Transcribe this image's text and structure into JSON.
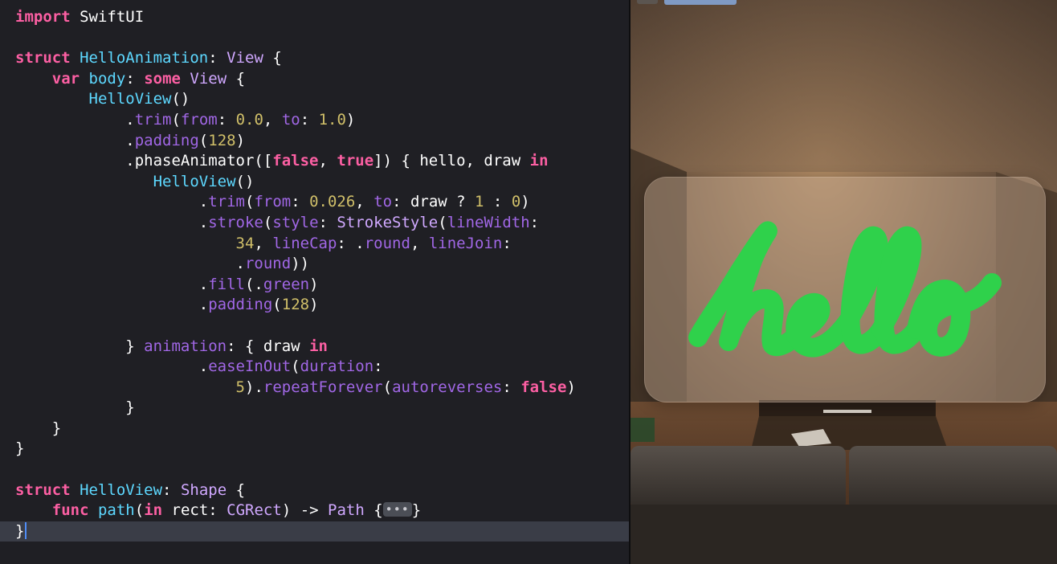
{
  "editor": {
    "lines": [
      [
        {
          "t": "import",
          "c": "kw"
        },
        {
          "t": " SwiftUI",
          "c": "pl"
        }
      ],
      [],
      [
        {
          "t": "struct",
          "c": "kw"
        },
        {
          "t": " ",
          "c": "pl"
        },
        {
          "t": "HelloAnimation",
          "c": "decl"
        },
        {
          "t": ": ",
          "c": "pl"
        },
        {
          "t": "View",
          "c": "ty"
        },
        {
          "t": " {",
          "c": "pl"
        }
      ],
      [
        {
          "t": "    ",
          "c": "pl"
        },
        {
          "t": "var",
          "c": "kw"
        },
        {
          "t": " ",
          "c": "pl"
        },
        {
          "t": "body",
          "c": "decl"
        },
        {
          "t": ": ",
          "c": "pl"
        },
        {
          "t": "some",
          "c": "kw"
        },
        {
          "t": " ",
          "c": "pl"
        },
        {
          "t": "View",
          "c": "ty"
        },
        {
          "t": " {",
          "c": "pl"
        }
      ],
      [
        {
          "t": "        ",
          "c": "pl"
        },
        {
          "t": "HelloView",
          "c": "decl"
        },
        {
          "t": "()",
          "c": "pl"
        }
      ],
      [
        {
          "t": "            .",
          "c": "pl"
        },
        {
          "t": "trim",
          "c": "prop"
        },
        {
          "t": "(",
          "c": "pl"
        },
        {
          "t": "from",
          "c": "prop"
        },
        {
          "t": ": ",
          "c": "pl"
        },
        {
          "t": "0.0",
          "c": "num"
        },
        {
          "t": ", ",
          "c": "pl"
        },
        {
          "t": "to",
          "c": "prop"
        },
        {
          "t": ": ",
          "c": "pl"
        },
        {
          "t": "1.0",
          "c": "num"
        },
        {
          "t": ")",
          "c": "pl"
        }
      ],
      [
        {
          "t": "            .",
          "c": "pl"
        },
        {
          "t": "padding",
          "c": "prop"
        },
        {
          "t": "(",
          "c": "pl"
        },
        {
          "t": "128",
          "c": "num"
        },
        {
          "t": ")",
          "c": "pl"
        }
      ],
      [
        {
          "t": "            .phaseAnimator([",
          "c": "pl"
        },
        {
          "t": "false",
          "c": "kw"
        },
        {
          "t": ", ",
          "c": "pl"
        },
        {
          "t": "true",
          "c": "kw"
        },
        {
          "t": "]) { hello, draw ",
          "c": "pl"
        },
        {
          "t": "in",
          "c": "kw"
        }
      ],
      [
        {
          "t": "               ",
          "c": "pl"
        },
        {
          "t": "HelloView",
          "c": "decl"
        },
        {
          "t": "()",
          "c": "pl"
        }
      ],
      [
        {
          "t": "                    .",
          "c": "pl"
        },
        {
          "t": "trim",
          "c": "prop"
        },
        {
          "t": "(",
          "c": "pl"
        },
        {
          "t": "from",
          "c": "prop"
        },
        {
          "t": ": ",
          "c": "pl"
        },
        {
          "t": "0.026",
          "c": "num"
        },
        {
          "t": ", ",
          "c": "pl"
        },
        {
          "t": "to",
          "c": "prop"
        },
        {
          "t": ": draw ? ",
          "c": "pl"
        },
        {
          "t": "1",
          "c": "num"
        },
        {
          "t": " : ",
          "c": "pl"
        },
        {
          "t": "0",
          "c": "num"
        },
        {
          "t": ")",
          "c": "pl"
        }
      ],
      [
        {
          "t": "                    .",
          "c": "pl"
        },
        {
          "t": "stroke",
          "c": "prop"
        },
        {
          "t": "(",
          "c": "pl"
        },
        {
          "t": "style",
          "c": "prop"
        },
        {
          "t": ": ",
          "c": "pl"
        },
        {
          "t": "StrokeStyle",
          "c": "ty"
        },
        {
          "t": "(",
          "c": "pl"
        },
        {
          "t": "lineWidth",
          "c": "prop"
        },
        {
          "t": ":",
          "c": "pl"
        }
      ],
      [
        {
          "t": "                        ",
          "c": "pl"
        },
        {
          "t": "34",
          "c": "num"
        },
        {
          "t": ", ",
          "c": "pl"
        },
        {
          "t": "lineCap",
          "c": "prop"
        },
        {
          "t": ": .",
          "c": "pl"
        },
        {
          "t": "round",
          "c": "prop"
        },
        {
          "t": ", ",
          "c": "pl"
        },
        {
          "t": "lineJoin",
          "c": "prop"
        },
        {
          "t": ":",
          "c": "pl"
        }
      ],
      [
        {
          "t": "                        .",
          "c": "pl"
        },
        {
          "t": "round",
          "c": "prop"
        },
        {
          "t": "))",
          "c": "pl"
        }
      ],
      [
        {
          "t": "                    .",
          "c": "pl"
        },
        {
          "t": "fill",
          "c": "prop"
        },
        {
          "t": "(.",
          "c": "pl"
        },
        {
          "t": "green",
          "c": "prop"
        },
        {
          "t": ")",
          "c": "pl"
        }
      ],
      [
        {
          "t": "                    .",
          "c": "pl"
        },
        {
          "t": "padding",
          "c": "prop"
        },
        {
          "t": "(",
          "c": "pl"
        },
        {
          "t": "128",
          "c": "num"
        },
        {
          "t": ")",
          "c": "pl"
        }
      ],
      [],
      [
        {
          "t": "            } ",
          "c": "pl"
        },
        {
          "t": "animation",
          "c": "prop"
        },
        {
          "t": ": { draw ",
          "c": "pl"
        },
        {
          "t": "in",
          "c": "kw"
        }
      ],
      [
        {
          "t": "                    .",
          "c": "pl"
        },
        {
          "t": "easeInOut",
          "c": "prop"
        },
        {
          "t": "(",
          "c": "pl"
        },
        {
          "t": "duration",
          "c": "prop"
        },
        {
          "t": ":",
          "c": "pl"
        }
      ],
      [
        {
          "t": "                        ",
          "c": "pl"
        },
        {
          "t": "5",
          "c": "num"
        },
        {
          "t": ").",
          "c": "pl"
        },
        {
          "t": "repeatForever",
          "c": "prop"
        },
        {
          "t": "(",
          "c": "pl"
        },
        {
          "t": "autoreverses",
          "c": "prop"
        },
        {
          "t": ": ",
          "c": "pl"
        },
        {
          "t": "false",
          "c": "kw"
        },
        {
          "t": ")",
          "c": "pl"
        }
      ],
      [
        {
          "t": "            }",
          "c": "pl"
        }
      ],
      [
        {
          "t": "    }",
          "c": "pl"
        }
      ],
      [
        {
          "t": "}",
          "c": "pl"
        }
      ],
      [],
      [
        {
          "t": "struct",
          "c": "kw"
        },
        {
          "t": " ",
          "c": "pl"
        },
        {
          "t": "HelloView",
          "c": "decl"
        },
        {
          "t": ": ",
          "c": "pl"
        },
        {
          "t": "Shape",
          "c": "ty"
        },
        {
          "t": " {",
          "c": "pl"
        }
      ],
      [
        {
          "t": "    ",
          "c": "pl"
        },
        {
          "t": "func",
          "c": "kw"
        },
        {
          "t": " ",
          "c": "pl"
        },
        {
          "t": "path",
          "c": "decl"
        },
        {
          "t": "(",
          "c": "pl"
        },
        {
          "t": "in",
          "c": "kw"
        },
        {
          "t": " rect: ",
          "c": "pl"
        },
        {
          "t": "CGRect",
          "c": "ty"
        },
        {
          "t": ") -> ",
          "c": "pl"
        },
        {
          "t": "Path",
          "c": "ty"
        },
        {
          "t": " {",
          "c": "pl"
        },
        {
          "t": "•••",
          "c": "fold"
        },
        {
          "t": "}",
          "c": "pl"
        }
      ],
      [
        {
          "t": "}",
          "c": "pl"
        },
        {
          "t": "",
          "c": "caret"
        }
      ]
    ],
    "current_line": 25
  },
  "preview": {
    "hello_text": "hello",
    "hello_color": "#2fd14b"
  },
  "colors": {
    "editor_bg": "#1f1f24",
    "keyword": "#fc5fa3",
    "declaration": "#5dd8ff",
    "type": "#d0a8ff",
    "property": "#a167e6",
    "number": "#d0bf69"
  }
}
